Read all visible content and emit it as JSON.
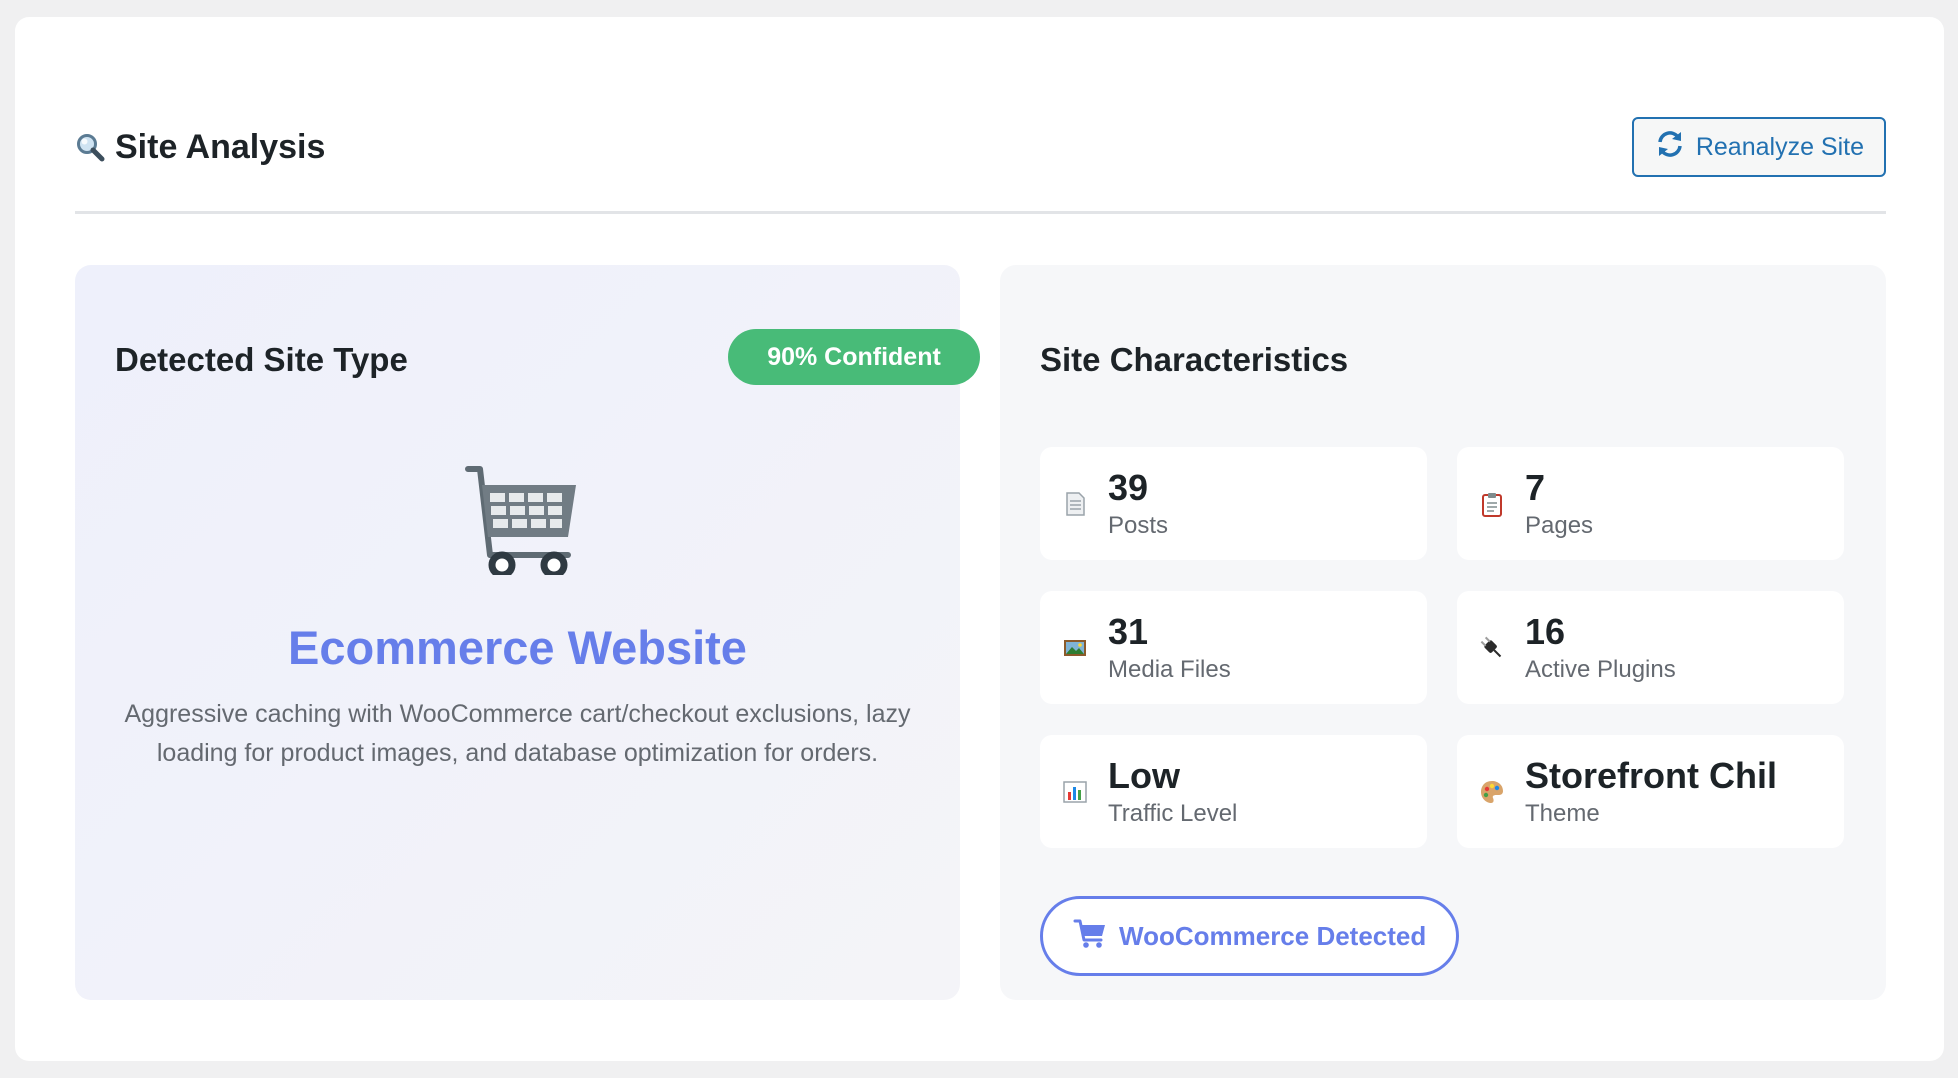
{
  "header": {
    "title": "Site Analysis",
    "title_icon": "magnifier-icon",
    "reanalyze_label": "Reanalyze Site",
    "reanalyze_icon": "refresh-icon"
  },
  "detected": {
    "heading": "Detected Site Type",
    "confidence_label": "90% Confident",
    "confidence": 0.9,
    "icon": "shopping-cart-icon",
    "site_type": "Ecommerce Website",
    "description": "Aggressive caching with WooCommerce cart/checkout exclusions, lazy loading for product images, and database optimization for orders."
  },
  "characteristics": {
    "heading": "Site Characteristics",
    "stats": [
      {
        "value": "39",
        "label": "Posts",
        "icon": "document-icon"
      },
      {
        "value": "7",
        "label": "Pages",
        "icon": "clipboard-icon"
      },
      {
        "value": "31",
        "label": "Media Files",
        "icon": "picture-icon"
      },
      {
        "value": "16",
        "label": "Active Plugins",
        "icon": "plug-icon"
      },
      {
        "value": "Low",
        "label": "Traffic Level",
        "icon": "bar-chart-icon"
      },
      {
        "value": "Storefront Chil",
        "label": "Theme",
        "icon": "palette-icon"
      }
    ],
    "woocommerce_label": "WooCommerce Detected",
    "woocommerce_icon": "cart-icon"
  },
  "colors": {
    "accent": "#667eea",
    "success": "#48bb78",
    "link": "#2271b1"
  }
}
